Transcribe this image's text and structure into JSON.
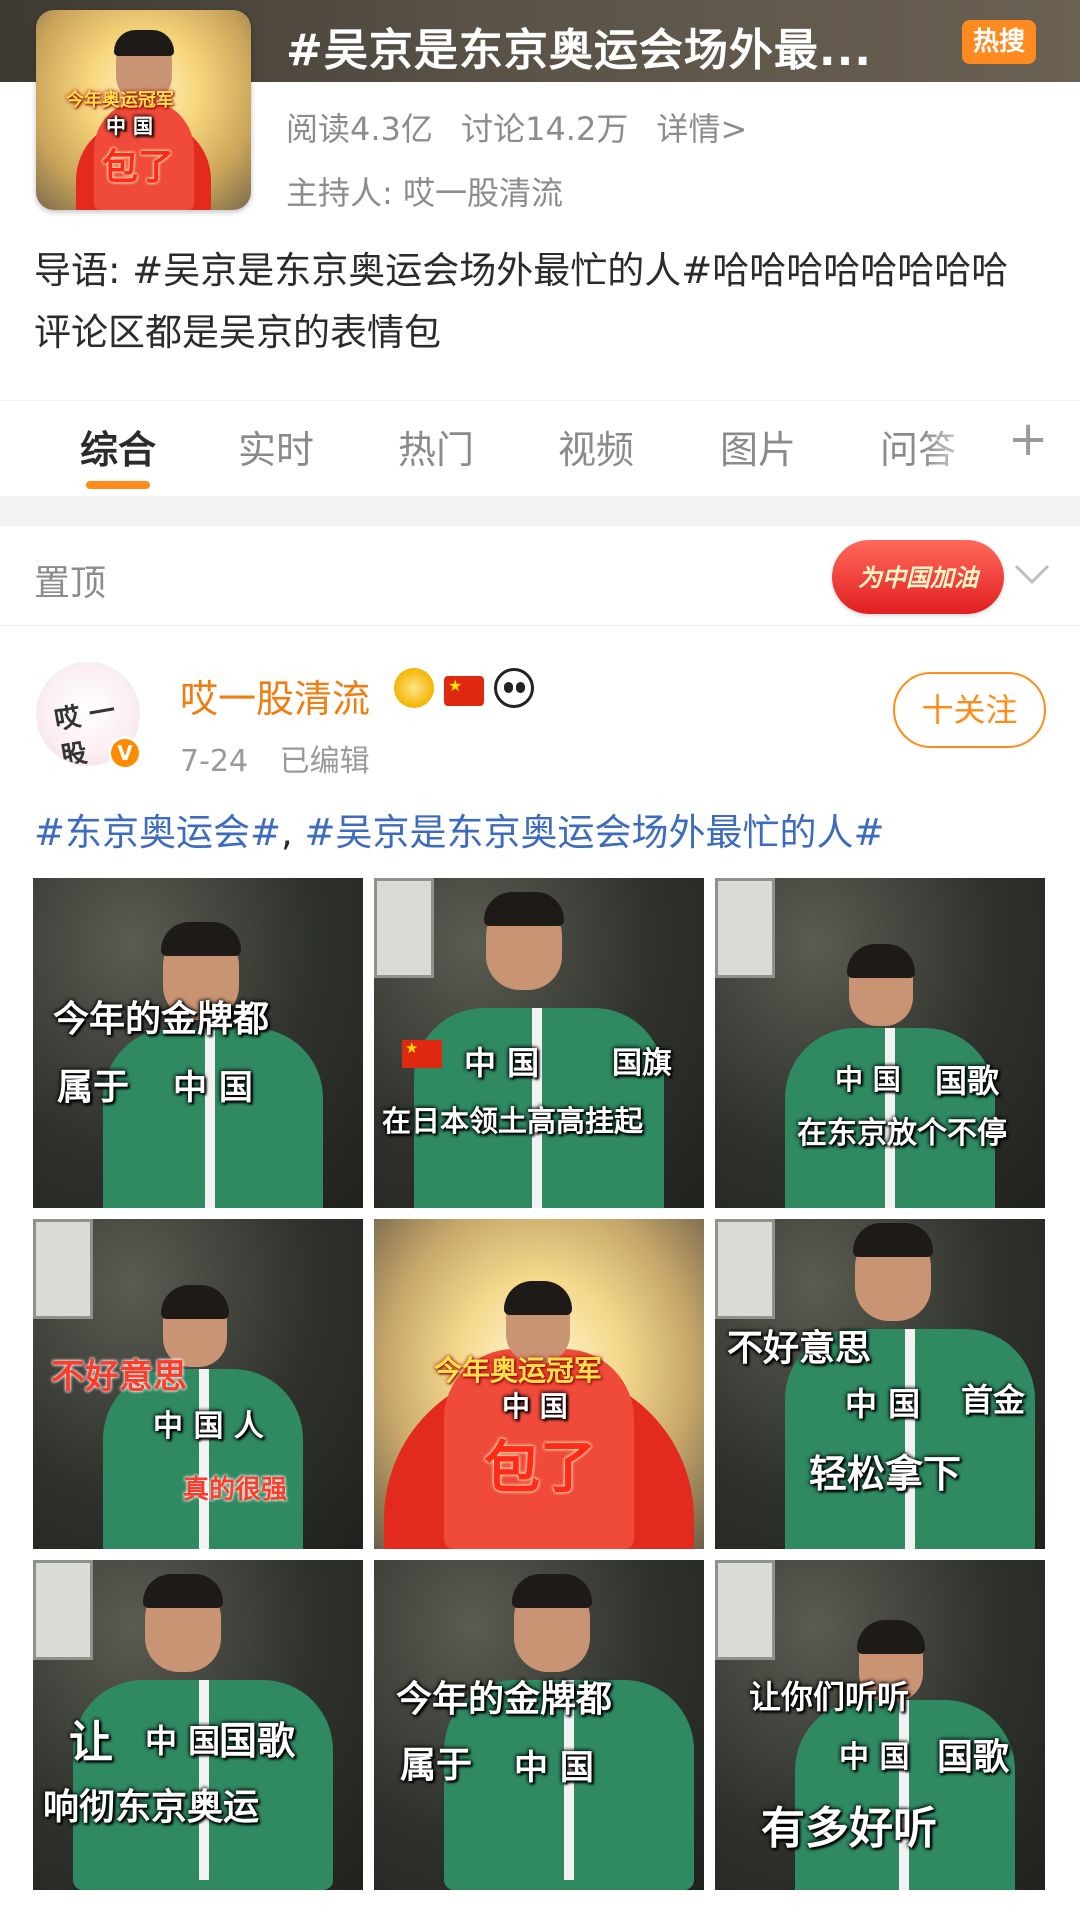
{
  "topic": {
    "title": "#吴京是东京奥运会场外最...",
    "hot_badge": "热搜",
    "stats": {
      "reads": "阅读4.3亿",
      "discussions": "讨论14.2万",
      "details": "详情>"
    },
    "host": "主持人: 哎一股清流",
    "intro": "导语: #吴京是东京奥运会场外最忙的人#哈哈哈哈哈哈哈哈评论区都是吴京的表情包",
    "cover": {
      "caption_top": "今年奥运冠军",
      "caption_mid": "中 国",
      "caption_bottom": "包了"
    }
  },
  "tabs": [
    {
      "label": "综合",
      "active": true
    },
    {
      "label": "实时",
      "active": false
    },
    {
      "label": "热门",
      "active": false
    },
    {
      "label": "视频",
      "active": false
    },
    {
      "label": "图片",
      "active": false
    },
    {
      "label": "问答",
      "active": false
    }
  ],
  "tab_add_icon": "+",
  "pinned": {
    "label": "置顶",
    "badge": "为中国加油",
    "chevron_icon": "chevron-down-icon"
  },
  "post": {
    "avatar_text": "哎 一股",
    "username": "哎一股清流",
    "emblems": [
      "crown-icon",
      "china-flag-icon",
      "panda-icon"
    ],
    "date": "7-24",
    "edited": "已编辑",
    "follow_label": "十关注",
    "text": {
      "tag1": "#东京奥运会#",
      "separator": ", ",
      "tag2": "#吴京是东京奥运会场外最忙的人#"
    },
    "images": [
      {
        "line1": "今年的金牌都",
        "line2": "属于",
        "jacket_text": "中 国"
      },
      {
        "line1": "国旗",
        "line2": "在日本领土高高挂起",
        "jacket_text": "中 国"
      },
      {
        "line1": "国歌",
        "line2": "在东京放个不停",
        "jacket_text": "中 国"
      },
      {
        "line1": "不好意思",
        "line2": "真的很强",
        "jacket_text": "中 国 人"
      },
      {
        "line1": "今年奥运冠军",
        "line2": "包了",
        "jacket_text": "中 国"
      },
      {
        "line1": "不好意思",
        "line2": "首金",
        "line3": "轻松拿下",
        "jacket_text": "中 国"
      },
      {
        "line1": "让",
        "line2": "国歌",
        "line3": "响彻东京奥运",
        "jacket_text": "中 国"
      },
      {
        "line1": "今年的金牌都",
        "line2": "属于",
        "jacket_text": "中 国"
      },
      {
        "line1": "让你们听听",
        "line2": "国歌",
        "line3": "有多好听",
        "jacket_text": "中 国"
      }
    ]
  },
  "colors": {
    "accent": "#ff8c1a",
    "username": "#f07d12",
    "hashtag": "#3d6bbf",
    "hot_badge": "#ff8a1f"
  }
}
